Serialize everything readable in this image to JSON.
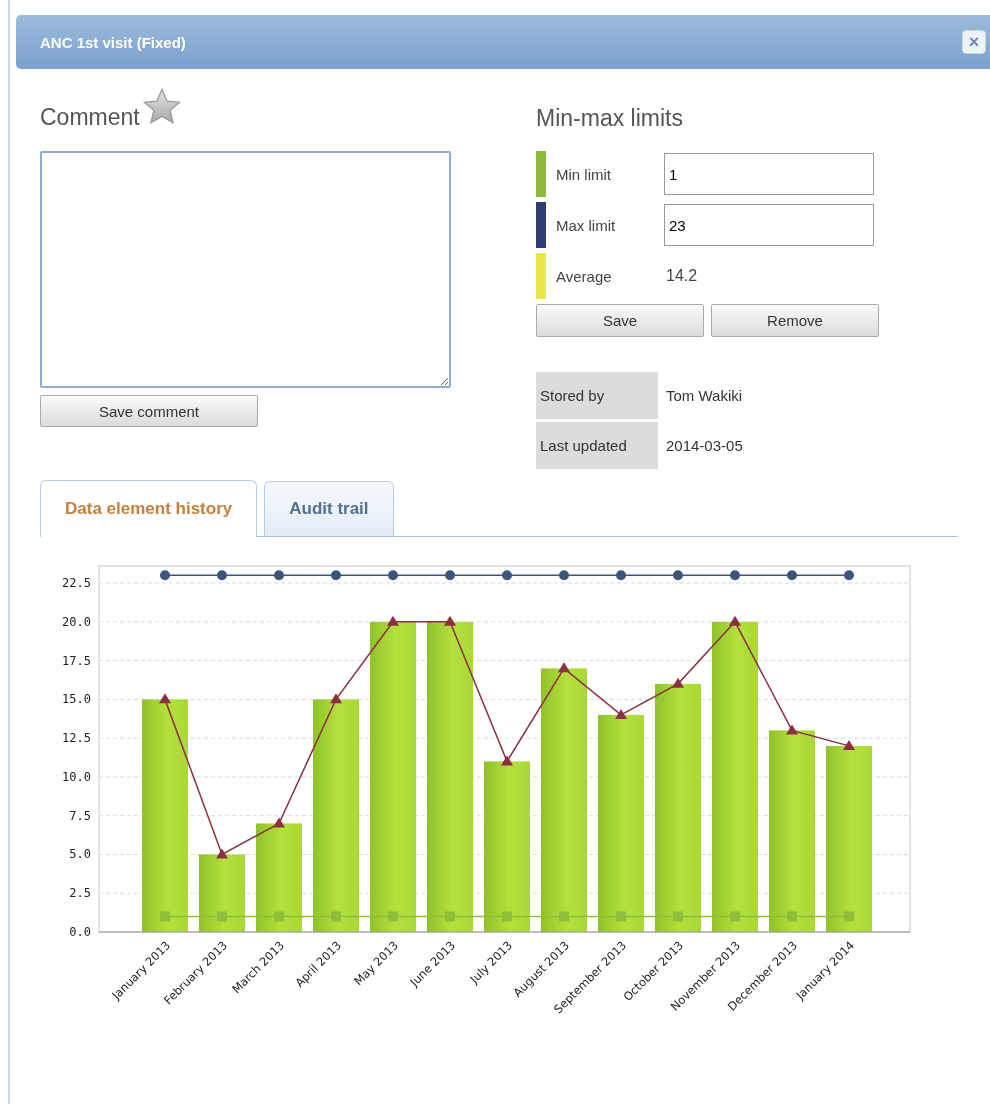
{
  "dialog": {
    "title": "ANC 1st visit (Fixed)",
    "close": "×"
  },
  "comment": {
    "heading": "Comment",
    "save_button": "Save comment"
  },
  "limits": {
    "heading": "Min-max limits",
    "items": [
      {
        "kind": "input",
        "label": "Min limit",
        "value": "1",
        "color": "#8db83e"
      },
      {
        "kind": "input",
        "label": "Max limit",
        "value": "23",
        "color": "#2f3f73"
      },
      {
        "kind": "text",
        "label": "Average",
        "value": "14.2",
        "color": "#e8e84a"
      }
    ],
    "buttons": [
      "Save",
      "Remove"
    ]
  },
  "info": [
    {
      "label": "Stored by",
      "value": "Tom Wakiki"
    },
    {
      "label": "Last updated",
      "value": "2014-03-05"
    }
  ],
  "tabs": [
    {
      "label": "Data element history",
      "selected": true
    },
    {
      "label": "Audit trail",
      "selected": false
    }
  ],
  "chart_data": {
    "type": "bar",
    "categories": [
      "January 2013",
      "February 2013",
      "March 2013",
      "April 2013",
      "May 2013",
      "June 2013",
      "July 2013",
      "August 2013",
      "September 2013",
      "October 2013",
      "November 2013",
      "December 2013",
      "January 2014"
    ],
    "ylim": [
      0,
      23.6
    ],
    "grid": true,
    "yticks": [
      {
        "value": 0,
        "label": "0.0"
      },
      {
        "value": 2.5,
        "label": "2.5"
      },
      {
        "value": 5,
        "label": "5.0"
      },
      {
        "value": 7.5,
        "label": "7.5"
      },
      {
        "value": 10,
        "label": "10.0"
      },
      {
        "value": 12.5,
        "label": "12.5"
      },
      {
        "value": 15,
        "label": "15.0"
      },
      {
        "value": 17.5,
        "label": "17.5"
      },
      {
        "value": 20,
        "label": "20.0"
      },
      {
        "value": 22.5,
        "label": "22.5"
      }
    ],
    "series": [
      {
        "type": "bar",
        "color": "#b5e03c",
        "values": [
          15,
          5,
          7,
          15,
          20,
          20,
          11,
          17,
          14,
          16,
          20,
          13,
          12
        ]
      },
      {
        "type": "line",
        "marker": "^",
        "color": "#8b3040",
        "values": [
          15,
          5,
          7,
          15,
          20,
          20,
          11,
          17,
          14,
          16,
          20,
          13,
          12
        ]
      },
      {
        "type": "line",
        "marker": "o",
        "color": "#3d5579",
        "values": [
          23,
          23,
          23,
          23,
          23,
          23,
          23,
          23,
          23,
          23,
          23,
          23,
          23
        ]
      },
      {
        "type": "line",
        "marker": "s",
        "color": "#8fbf3a",
        "values": [
          1,
          1,
          1,
          1,
          1,
          1,
          1,
          1,
          1,
          1,
          1,
          1,
          1
        ]
      }
    ]
  }
}
